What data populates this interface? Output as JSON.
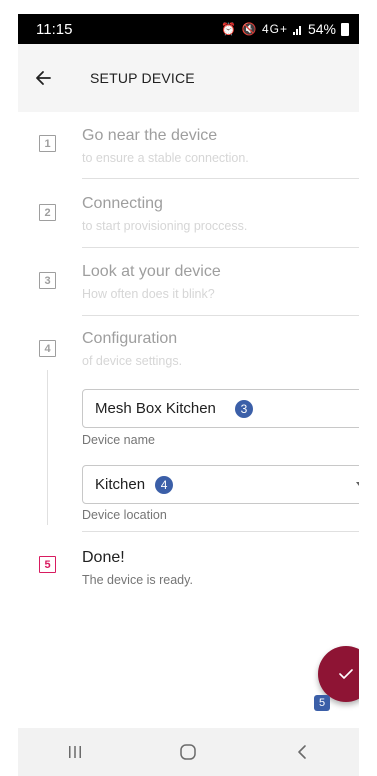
{
  "status_bar": {
    "time": "11:15",
    "icons": "⏰ 🔇 4G+",
    "battery_text": "54%"
  },
  "app_bar": {
    "title": "SETUP DEVICE",
    "back_icon": "arrow-back-icon"
  },
  "steps": [
    {
      "number": "1",
      "title": "Go near the device",
      "subtitle": "to ensure a stable connection."
    },
    {
      "number": "2",
      "title": "Connecting",
      "subtitle": "to start provisioning proccess."
    },
    {
      "number": "3",
      "title": "Look at your device",
      "subtitle": "How often does it blink?"
    },
    {
      "number": "4",
      "title": "Configuration",
      "subtitle": "of device settings."
    },
    {
      "number": "5",
      "title": "Done!",
      "subtitle": "The device is ready."
    }
  ],
  "form": {
    "device_name": {
      "value": "Mesh Box Kitchen",
      "label": "Device name",
      "badge": "3"
    },
    "device_location": {
      "value": "Kitchen",
      "label": "Device location",
      "badge": "4"
    }
  },
  "fab": {
    "icon": "check-icon",
    "badge": "5"
  },
  "colors": {
    "accent": "#d81b60",
    "fab": "#8e1434",
    "badge": "#3b5fa8"
  }
}
